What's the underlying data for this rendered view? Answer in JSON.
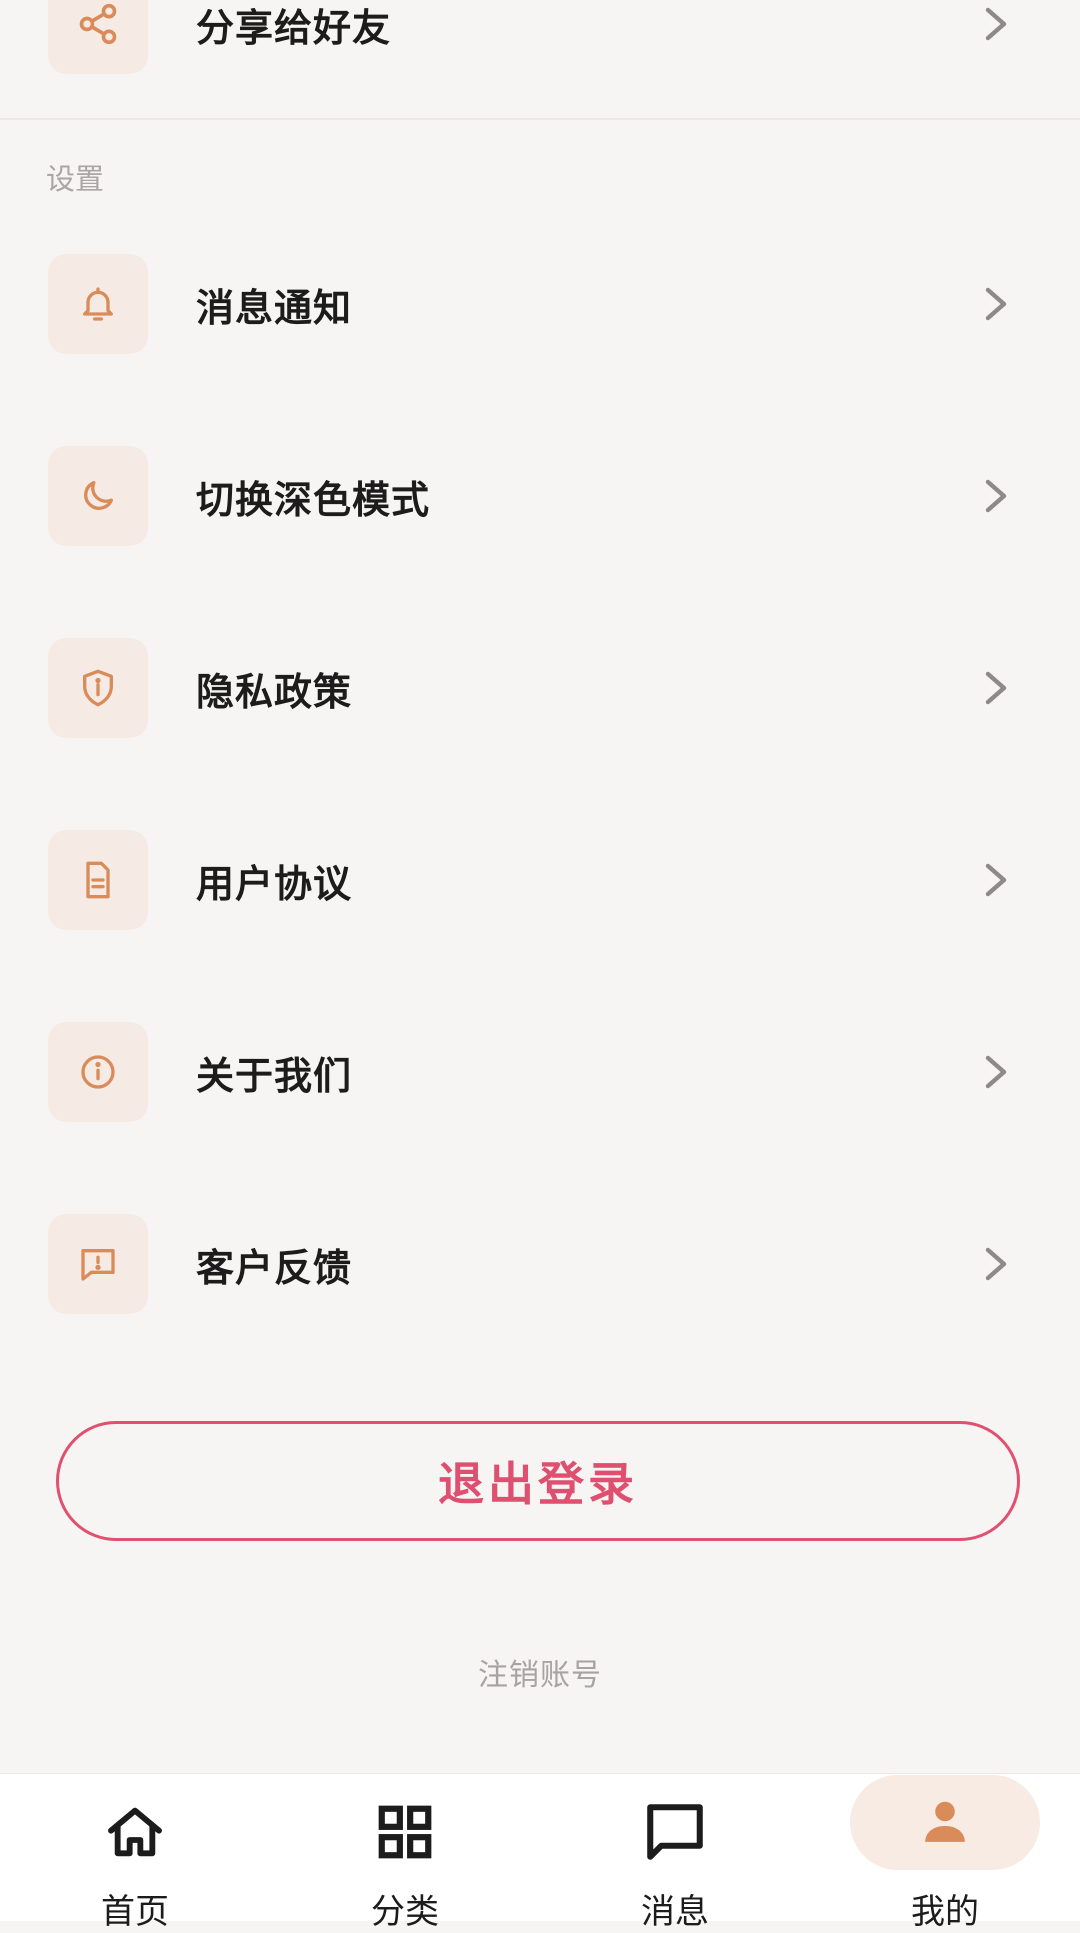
{
  "share_row": {
    "label": "分享给好友",
    "icon": "share-icon"
  },
  "settings_section": {
    "title": "设置",
    "items": [
      {
        "label": "消息通知",
        "icon": "bell-icon"
      },
      {
        "label": "切换深色模式",
        "icon": "moon-icon"
      },
      {
        "label": "隐私政策",
        "icon": "shield-icon"
      },
      {
        "label": "用户协议",
        "icon": "document-icon"
      },
      {
        "label": "关于我们",
        "icon": "info-icon"
      },
      {
        "label": "客户反馈",
        "icon": "feedback-icon"
      }
    ]
  },
  "logout_button": {
    "label": "退出登录"
  },
  "cancel_account": {
    "label": "注销账号"
  },
  "tabbar": {
    "active": "我的",
    "tabs": [
      {
        "label": "首页",
        "icon": "home-icon"
      },
      {
        "label": "分类",
        "icon": "grid-icon"
      },
      {
        "label": "消息",
        "icon": "message-icon"
      },
      {
        "label": "我的",
        "icon": "user-icon"
      }
    ]
  },
  "colors": {
    "accent": "#d98c5a",
    "icon_bg": "#f6ebe4",
    "logout": "#e0506f",
    "background": "#f7f5f3"
  }
}
